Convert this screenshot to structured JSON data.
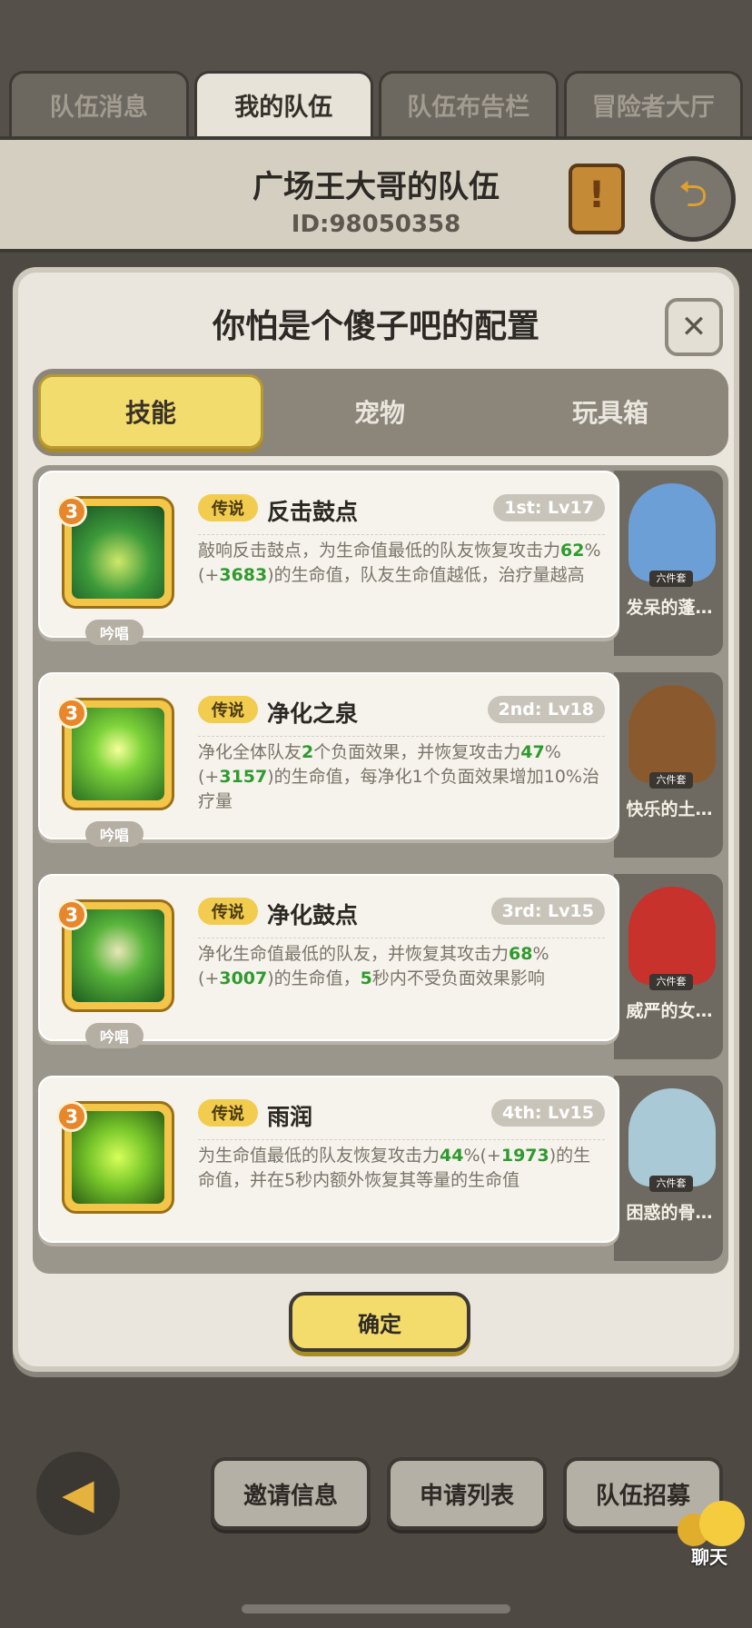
{
  "top_tabs": [
    {
      "label": "队伍消息",
      "active": false
    },
    {
      "label": "我的队伍",
      "active": true
    },
    {
      "label": "队伍布告栏",
      "active": false
    },
    {
      "label": "冒险者大厅",
      "active": false
    }
  ],
  "team": {
    "name": "广场王大哥的队伍",
    "id": "ID:98050358"
  },
  "modal": {
    "title": "你怕是个傻子吧的配置",
    "close_label": "✕",
    "tabs": [
      {
        "label": "技能",
        "active": true
      },
      {
        "label": "宠物",
        "active": false
      },
      {
        "label": "玩具箱",
        "active": false
      }
    ],
    "skills": [
      {
        "level_badge": "3",
        "rarity": "传说",
        "name": "反击鼓点",
        "lv": "1st: Lv17",
        "chant": "吟唱",
        "desc": [
          {
            "t": "敲响反击鼓点，为生命值最低的队友恢复攻击力"
          },
          {
            "t": "62",
            "g": true
          },
          {
            "t": "%(+"
          },
          {
            "t": "3683",
            "g": true
          },
          {
            "t": ")的生命值，队友生命值越低，治疗量越高"
          }
        ],
        "pet_name": "发呆的蓬…",
        "pet_badge": "六件套",
        "pet_color": "#6c9fd6"
      },
      {
        "level_badge": "3",
        "rarity": "传说",
        "name": "净化之泉",
        "lv": "2nd: Lv18",
        "chant": "吟唱",
        "desc": [
          {
            "t": "净化全体队友"
          },
          {
            "t": "2",
            "g": true
          },
          {
            "t": "个负面效果，并恢复攻击力"
          },
          {
            "t": "47",
            "g": true
          },
          {
            "t": "%(+"
          },
          {
            "t": "3157",
            "g": true
          },
          {
            "t": ")的生命值，每净化1个负面效果增加10%治疗量"
          }
        ],
        "pet_name": "快乐的土…",
        "pet_badge": "六件套",
        "pet_color": "#8a5a2e"
      },
      {
        "level_badge": "3",
        "rarity": "传说",
        "name": "净化鼓点",
        "lv": "3rd: Lv15",
        "chant": "吟唱",
        "desc": [
          {
            "t": "净化生命值最低的队友，并恢复其攻击力"
          },
          {
            "t": "68",
            "g": true
          },
          {
            "t": "%(+"
          },
          {
            "t": "3007",
            "g": true
          },
          {
            "t": ")的生命值，"
          },
          {
            "t": "5",
            "g": true
          },
          {
            "t": "秒内不受负面效果影响"
          }
        ],
        "pet_name": "威严的女…",
        "pet_badge": "六件套",
        "pet_color": "#c8322c"
      },
      {
        "level_badge": "3",
        "rarity": "传说",
        "name": "雨润",
        "lv": "4th: Lv15",
        "chant": "",
        "desc": [
          {
            "t": "为生命值最低的队友恢复攻击力"
          },
          {
            "t": "44",
            "g": true
          },
          {
            "t": "%(+"
          },
          {
            "t": "1973",
            "g": true
          },
          {
            "t": ")的生命值，并在5秒内额外恢复其等量的生命值"
          }
        ],
        "pet_name": "困惑的骨…",
        "pet_badge": "六件套",
        "pet_color": "#a9c9d6"
      }
    ],
    "confirm_label": "确定"
  },
  "bottom": {
    "invite_label": "邀请信息",
    "apply_label": "申请列表",
    "recruit_label": "队伍招募",
    "chat_label": "聊天"
  },
  "colors": {
    "accent": "#f3dc6e",
    "highlight_green": "#2f9a2f",
    "level_badge": "#e7862b"
  }
}
